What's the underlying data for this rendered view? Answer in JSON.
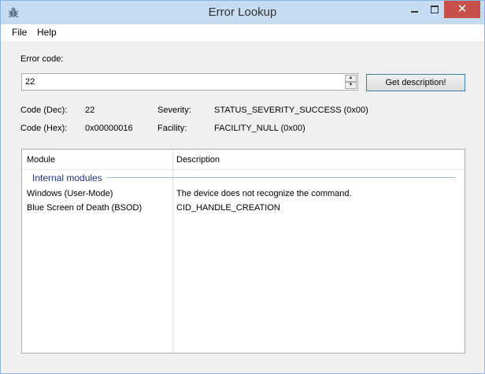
{
  "window": {
    "title": "Error Lookup"
  },
  "menu": {
    "file": "File",
    "help": "Help"
  },
  "form": {
    "error_code_label": "Error code:",
    "error_code_value": "22",
    "get_description_label": "Get description!"
  },
  "info": {
    "code_dec_label": "Code (Dec):",
    "code_dec_value": "22",
    "code_hex_label": "Code (Hex):",
    "code_hex_value": "0x00000016",
    "severity_label": "Severity:",
    "severity_value": "STATUS_SEVERITY_SUCCESS (0x00)",
    "facility_label": "Facility:",
    "facility_value": "FACILITY_NULL (0x00)"
  },
  "results": {
    "columns": [
      "Module",
      "Description"
    ],
    "group": "Internal modules",
    "rows": [
      {
        "module": "Windows (User-Mode)",
        "description": "The device does not recognize the command."
      },
      {
        "module": "Blue Screen of Death (BSOD)",
        "description": "CID_HANDLE_CREATION"
      }
    ]
  },
  "colors": {
    "titlebar": "#c6dcf3",
    "close_button": "#c7504b",
    "group_title": "#1e3287"
  },
  "icons": {
    "app": "bug-icon",
    "spin_up": "arrow-up-icon",
    "spin_down": "arrow-down-icon"
  }
}
